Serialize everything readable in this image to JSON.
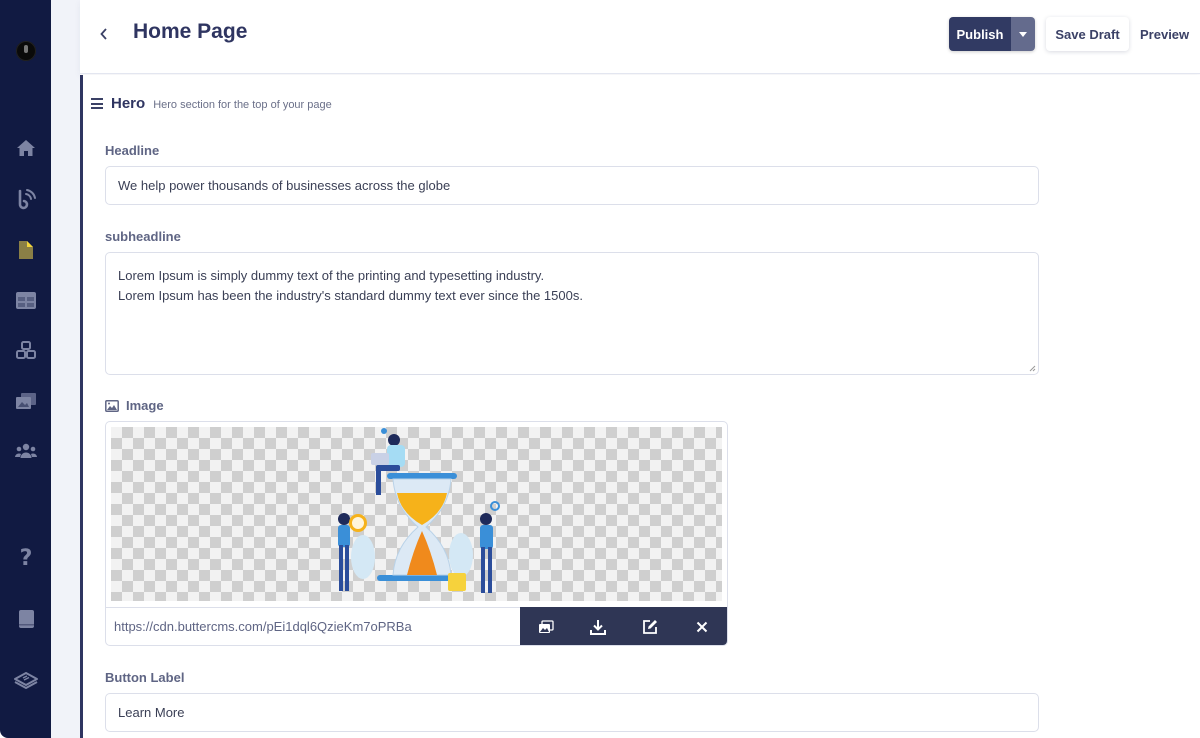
{
  "sidebar": {
    "items": [
      {
        "name": "home",
        "icon": "home-icon"
      },
      {
        "name": "blog",
        "icon": "blog-feed-icon"
      },
      {
        "name": "pages",
        "icon": "page-icon",
        "active": true
      },
      {
        "name": "collections",
        "icon": "table-icon"
      },
      {
        "name": "components",
        "icon": "cubes-icon"
      },
      {
        "name": "media",
        "icon": "media-library-icon"
      },
      {
        "name": "users",
        "icon": "users-icon"
      },
      {
        "name": "help",
        "icon": "help-icon"
      },
      {
        "name": "docs",
        "icon": "book-icon"
      },
      {
        "name": "integrations",
        "icon": "layers-icon"
      }
    ]
  },
  "header": {
    "title": "Home Page",
    "publish_label": "Publish",
    "save_draft_label": "Save Draft",
    "preview_label": "Preview"
  },
  "section": {
    "title": "Hero",
    "description": "Hero section for the top of your page"
  },
  "fields": {
    "headline": {
      "label": "Headline",
      "value": "We help power thousands of businesses across the globe"
    },
    "subheadline": {
      "label": "subheadline",
      "line1": "Lorem Ipsum is simply dummy text of the printing and typesetting industry.",
      "line2": "Lorem Ipsum has been the industry's standard dummy text ever since the 1500s."
    },
    "image": {
      "label": "Image",
      "url": "https://cdn.buttercms.com/pEi1dql6QzieKm7oPRBa",
      "alt": "People around an hourglass illustration"
    },
    "button_label": {
      "label": "Button Label",
      "value": "Learn More"
    }
  },
  "colors": {
    "sidebar_bg": "#111a42",
    "primary": "#313a63",
    "active_icon": "#f2d43c"
  }
}
